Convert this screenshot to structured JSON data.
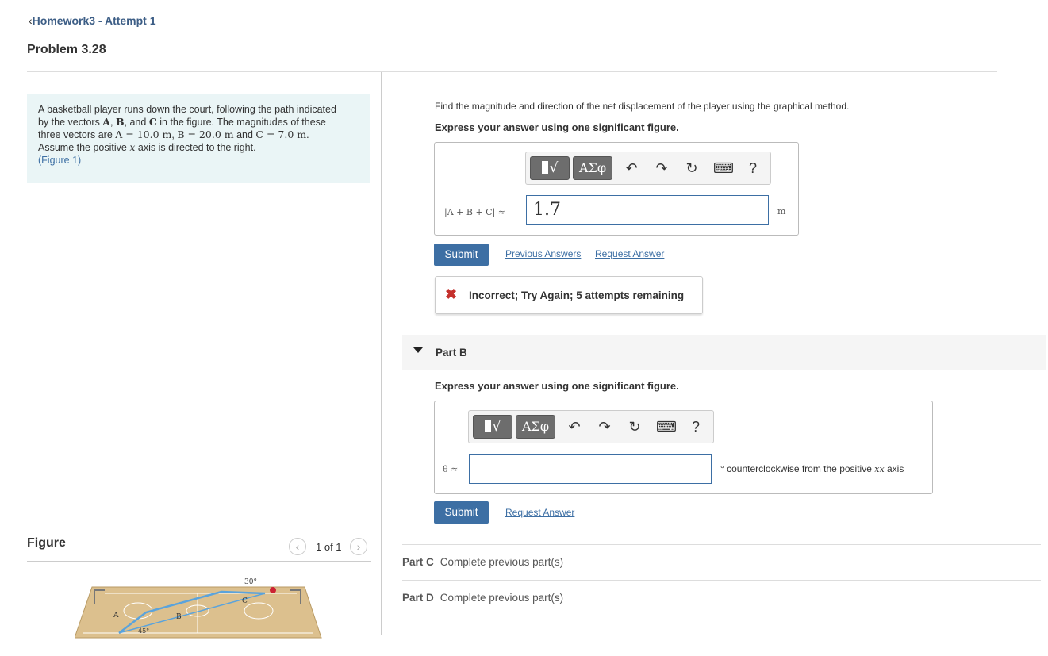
{
  "header": {
    "breadcrumb": "Homework3 - Attempt 1",
    "problem_title": "Problem 3.28"
  },
  "statement": {
    "line1": "A basketball player runs down the court, following the path indicated",
    "line2_pre": "by the vectors ",
    "vec_a": "A",
    "comma": ", ",
    "vec_b": "B",
    "and": ", and ",
    "vec_c": "C",
    "line2_post": " in the figure. The magnitudes of these",
    "line3_pre": "three vectors are ",
    "mag_a": "A = 10.0 m",
    "mag_b": "B = 20.0 m",
    "and2": " and ",
    "mag_c": "C = 7.0 m",
    "line3_end": ".",
    "line4_pre": "Assume the positive ",
    "x_var": "x",
    "line4_post": " axis is directed to the right.",
    "figure_link": "(Figure 1)"
  },
  "figure": {
    "label": "Figure",
    "prev_icon": "chevron-left-icon",
    "next_icon": "chevron-right-icon",
    "counter": "1 of 1",
    "angle_c": "30°",
    "angle_a": "45°",
    "label_a": "A",
    "label_b": "B",
    "label_c": "C"
  },
  "part_a": {
    "prompt": "Find the magnitude and direction of the net displacement of the player using the graphical method.",
    "instruction": "Express your answer using one significant figure.",
    "label": "|A + B + C| ≈",
    "value": "1.7",
    "unit": "m",
    "submit": "Submit",
    "previous_answers": "Previous Answers",
    "request_answer": "Request Answer",
    "feedback": "Incorrect; Try Again; 5 attempts remaining"
  },
  "toolbar": {
    "template": "√",
    "greek": "ΑΣφ",
    "undo": "↶",
    "redo": "↷",
    "reset": "↻",
    "keyboard": "⌨",
    "help": "?"
  },
  "part_b": {
    "title": "Part B",
    "instruction": "Express your answer using one significant figure.",
    "label": "θ ≈",
    "value": "",
    "unit_pre": "° counterclockwise from the positive ",
    "unit_var": "x",
    "unit_post": " axis",
    "submit": "Submit",
    "request_answer": "Request Answer"
  },
  "part_c": {
    "title": "Part C",
    "status": "Complete previous part(s)"
  },
  "part_d": {
    "title": "Part D",
    "status": "Complete previous part(s)"
  },
  "colors": {
    "accent": "#3d6fa4",
    "statement_bg": "#eaf5f6",
    "error": "#c5302c",
    "vector": "#5aa3dc",
    "court": "#dcc08e"
  }
}
